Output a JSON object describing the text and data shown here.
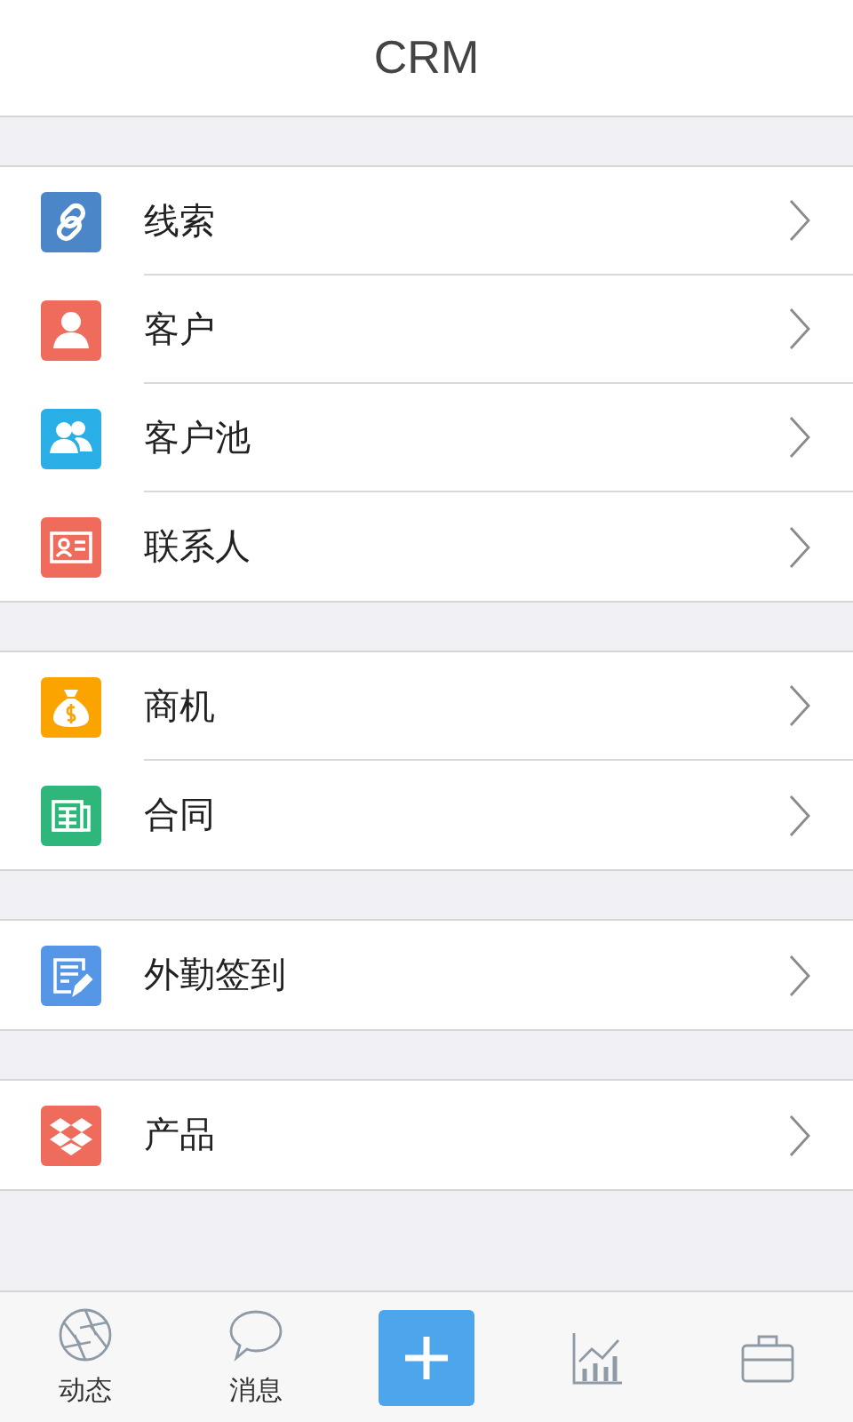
{
  "header": {
    "title": "CRM"
  },
  "groups": [
    {
      "items": [
        {
          "label": "线索",
          "kind": "link",
          "color": "#4a86c8"
        },
        {
          "label": "客户",
          "kind": "person",
          "color": "#ef6b5c"
        },
        {
          "label": "客户池",
          "kind": "people",
          "color": "#29aee6"
        },
        {
          "label": "联系人",
          "kind": "card",
          "color": "#ef6b5c"
        }
      ]
    },
    {
      "items": [
        {
          "label": "商机",
          "kind": "moneybag",
          "color": "#fba400"
        },
        {
          "label": "合同",
          "kind": "newspaper",
          "color": "#2fb67b"
        }
      ]
    },
    {
      "items": [
        {
          "label": "外勤签到",
          "kind": "form",
          "color": "#5596e6"
        }
      ]
    },
    {
      "items": [
        {
          "label": "产品",
          "kind": "boxes",
          "color": "#ef6b5c"
        }
      ]
    }
  ],
  "tab_bar": [
    {
      "kind": "aperture",
      "label": "动态"
    },
    {
      "kind": "bubble",
      "label": "消息"
    },
    {
      "kind": "add"
    },
    {
      "kind": "chart"
    },
    {
      "kind": "briefcase"
    }
  ]
}
